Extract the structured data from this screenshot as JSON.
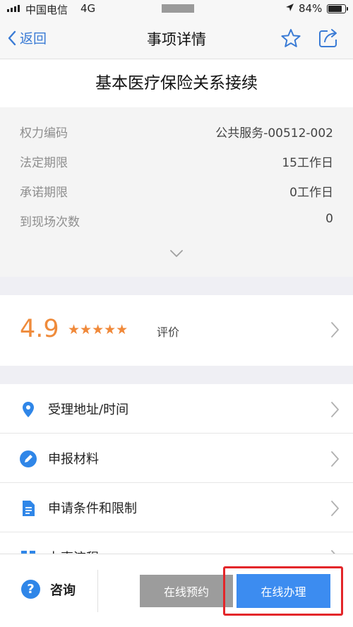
{
  "status_bar": {
    "carrier": "中国电信",
    "network": "4G",
    "battery_percent": "84%",
    "battery_level": 0.84,
    "location_icon": "location-arrow-icon"
  },
  "nav": {
    "back_label": "返回",
    "title": "事项详情",
    "icons": [
      "chevron-left-icon",
      "star-icon",
      "share-icon"
    ]
  },
  "item_title": "基本医疗保险关系接续",
  "info": {
    "rows": [
      {
        "label": "权力编码",
        "value": "公共服务-00512-002"
      },
      {
        "label": "法定期限",
        "value": "15工作日"
      },
      {
        "label": "承诺期限",
        "value": "0工作日"
      },
      {
        "label": "到现场次数",
        "value": "0"
      }
    ],
    "expand_icon": "chevron-down-icon"
  },
  "rating": {
    "score": "4.9",
    "stars": "★★★★★",
    "star_count": 5,
    "label": "评价"
  },
  "menu": [
    {
      "label": "受理地址/时间",
      "icon": "location-pin-icon"
    },
    {
      "label": "申报材料",
      "icon": "edit-icon"
    },
    {
      "label": "申请条件和限制",
      "icon": "document-icon"
    },
    {
      "label": "办事流程",
      "icon": "flow-icon"
    }
  ],
  "bottom_bar": {
    "consult_icon_text": "?",
    "consult_label": "咨询",
    "book_label": "在线预约",
    "online_label": "在线办理"
  },
  "colors": {
    "accent_blue": "#3c8cf0",
    "rating_orange": "#ef8b3b",
    "highlight_red": "#e3262a",
    "disabled_gray": "#9c9c9c"
  }
}
